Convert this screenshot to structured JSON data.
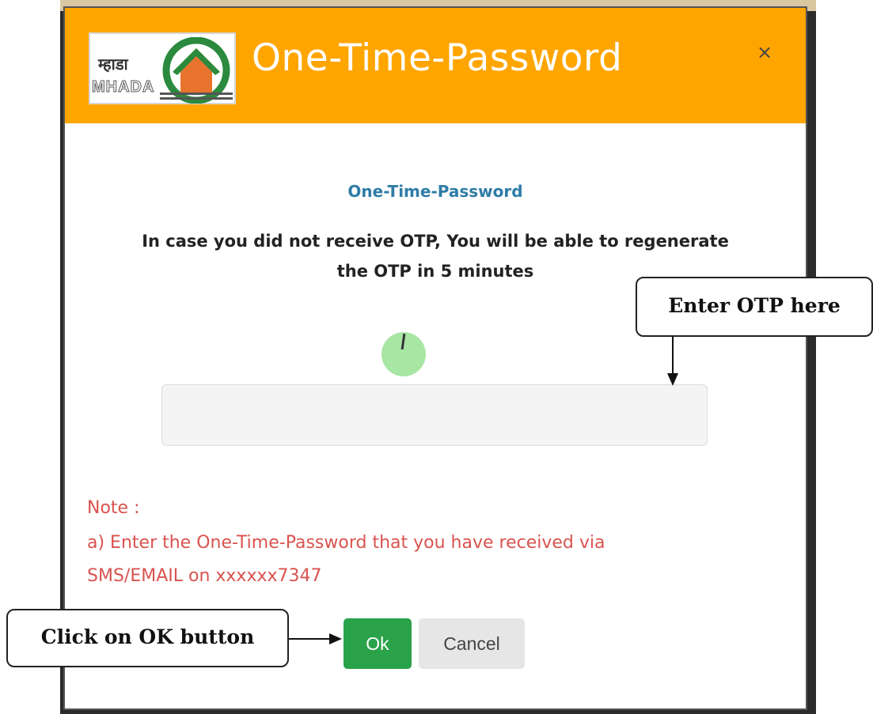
{
  "modal": {
    "header_title": "One-Time-Password",
    "close_symbol": "×",
    "logo": {
      "marathi": "म्हाडा",
      "latin": "MHADA"
    },
    "sub_title": "One-Time-Password",
    "info_line1": "In case you did not receive OTP, You will be able to regenerate",
    "info_line2": "the OTP in 5 minutes",
    "otp_input": {
      "value": "",
      "placeholder": ""
    },
    "note_label": "Note :",
    "note_line1": "a) Enter the One-Time-Password that you have received via",
    "note_line2": "SMS/EMAIL on xxxxxx7347",
    "ok_label": "Ok",
    "cancel_label": "Cancel"
  },
  "callouts": {
    "enter_otp": "Enter OTP here",
    "click_ok": "Click on OK button"
  },
  "colors": {
    "header": "#ffa500",
    "ok_button": "#2aa24a",
    "note_text": "#d9534f",
    "sub_title": "#2e7ca7"
  },
  "icons": [
    "close-icon",
    "loading-spinner-icon",
    "mhada-house-logo"
  ]
}
